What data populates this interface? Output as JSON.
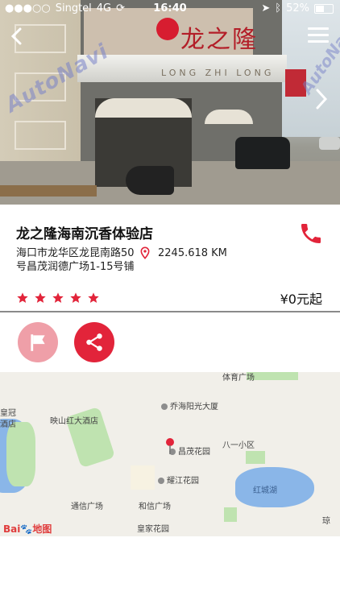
{
  "status_bar": {
    "carrier": "Singtel",
    "network": "4G",
    "time": "16:40",
    "battery": "52%",
    "battery_level": 0.52
  },
  "hero": {
    "sign_text": "龙之隆",
    "canopy_text": "LONG ZHI LONG",
    "watermark": "AutoNavi"
  },
  "store": {
    "name": "龙之隆海南沉香体验店",
    "address": "海口市龙华区龙昆南路50号昌茂润德广场1-15号铺",
    "distance": "2245.618 KM",
    "rating": 5,
    "price": "¥0元起"
  },
  "map": {
    "labels": [
      "体育广场",
      "皇冠",
      "酒店",
      "乔海阳光大厦",
      "映山红大酒店",
      "昌茂花园",
      "八一小区",
      "耀江花园",
      "红城湖",
      "通信广场",
      "和信广场",
      "皇家花园",
      "琼"
    ],
    "logo_part1": "Bai",
    "logo_part2": "地图"
  },
  "colors": {
    "accent": "#e2243a",
    "flag_bg": "#ef9fa8"
  }
}
